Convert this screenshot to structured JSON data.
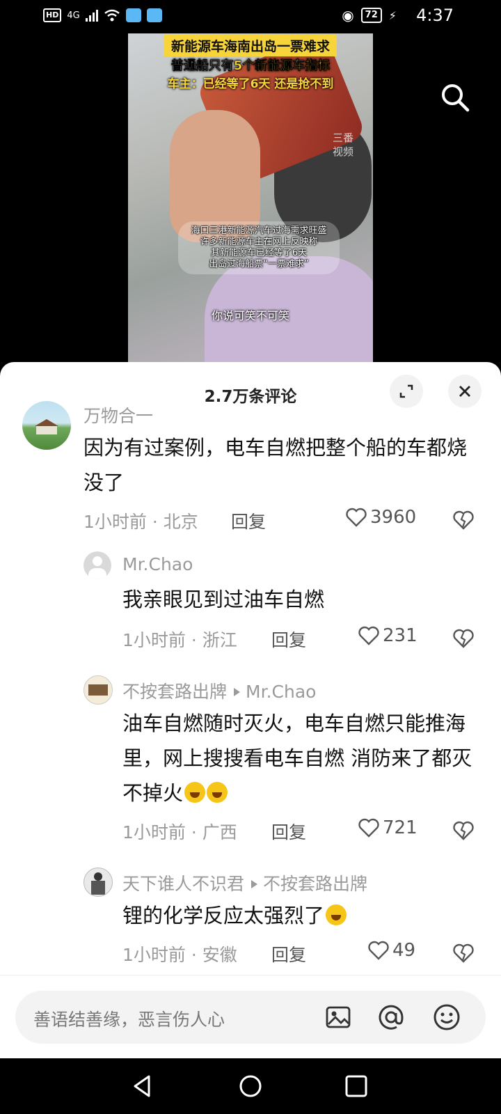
{
  "status_bar": {
    "network": "HD",
    "signal": "4G",
    "battery": "72",
    "time": "4:37"
  },
  "video": {
    "caption_title": "新能源车海南出岛一票难求",
    "caption_line2_prefix": "普通船只有",
    "caption_line2_highlight": "5个新能源车指标",
    "caption_line3": "车主：已经等了6天 还是抢不到",
    "watermark_line1": "三番",
    "watermark_line2": "视频",
    "subtitle_block": [
      "海口三港新能源汽车过海需求旺盛",
      "许多新能源车主在网上反映称",
      "其新能源车已经等了6天",
      "出岛过海船票“一票难求”"
    ],
    "subtitle_bottom": "你说可笑不可笑"
  },
  "comments_sheet": {
    "title": "2.7万条评论",
    "comments": [
      {
        "user": "万物合一",
        "text": "因为有过案例，电车自燃把整个船的车都烧没了",
        "meta": "1小时前 · 北京",
        "reply_label": "回复",
        "likes": "3960"
      },
      {
        "user": "Mr.Chao",
        "text": "我亲眼见到过油车自燃",
        "meta": "1小时前 · 浙江",
        "reply_label": "回复",
        "likes": "231"
      },
      {
        "user": "不按套路出牌",
        "reply_to": "Mr.Chao",
        "text": "油车自燃随时灭火，电车自燃只能推海里，网上搜搜看电车自燃 消防来了都灭不掉火",
        "meta": "1小时前 · 广西",
        "reply_label": "回复",
        "likes": "721"
      },
      {
        "user": "天下谁人不识君",
        "reply_to": "不按套路出牌",
        "text": "锂的化学反应太强烈了",
        "meta": "1小时前 · 安徽",
        "reply_label": "回复",
        "likes": "49"
      }
    ]
  },
  "input_bar": {
    "placeholder": "善语结善缘，恶言伤人心"
  }
}
